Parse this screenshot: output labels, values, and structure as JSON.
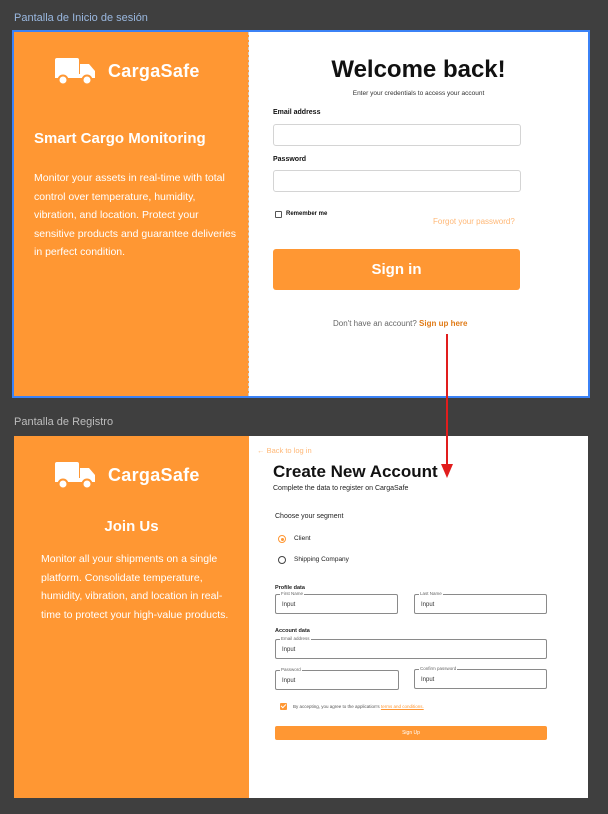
{
  "frames": {
    "login_label": "Pantalla de Inicio de sesión",
    "register_label": "Pantalla de Registro"
  },
  "brand": {
    "name": "CargaSafe",
    "icon": "truck-icon"
  },
  "login": {
    "headline": "Smart Cargo Monitoring",
    "description": "Monitor your assets in real-time with total control over temperature, humidity, vibration, and location. Protect your sensitive products and guarantee deliveries in perfect condition.",
    "title": "Welcome back!",
    "subtitle": "Enter your credentials to access your account",
    "email_label": "Email address",
    "email_value": "",
    "password_label": "Password",
    "password_value": "",
    "remember_label": "Remember me",
    "forgot_link": "Forgot your password?",
    "signin_button": "Sign in",
    "no_account_text": "Don't have an account?",
    "signup_link": "Sign up here"
  },
  "register": {
    "headline": "Join Us",
    "description": "Monitor all your shipments on a single platform. Consolidate temperature, humidity, vibration, and location in real-time to protect your high-value products.",
    "back_link": "← Back to log in",
    "title": "Create New Account",
    "subtitle": "Complete the data to register on CargaSafe",
    "segment_title": "Choose your segment",
    "segments": [
      {
        "label": "Client",
        "selected": true
      },
      {
        "label": "Shipping Company",
        "selected": false
      }
    ],
    "profile_section": "Profile data",
    "first_name_label": "First Name",
    "first_name_value": "Input",
    "last_name_label": "Last Name",
    "last_name_value": "Input",
    "account_section": "Account data",
    "email_label": "Email address",
    "email_value": "Input",
    "password_label": "Password",
    "password_value": "Input",
    "confirm_label": "Confirm password",
    "confirm_value": "Input",
    "terms_text": "By accepting, you agree to the application's",
    "terms_link": "terms and conditions.",
    "terms_checked": true,
    "signup_button": "Sign Up"
  },
  "colors": {
    "accent": "#ff9733",
    "link": "#e07b17",
    "connector": "#e11d1d"
  }
}
